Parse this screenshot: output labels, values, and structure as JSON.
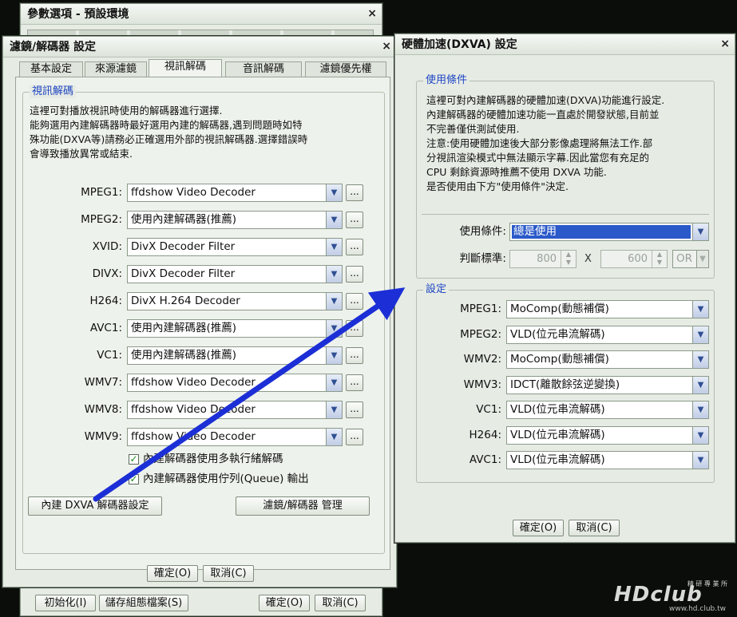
{
  "bg_window": {
    "title": "參數選項 - 預設環境",
    "close": "×",
    "footer": {
      "init_btn": "初始化(I)",
      "save_profile_btn": "儲存組態檔案(S)",
      "ok_btn": "確定(O)",
      "cancel_btn": "取消(C)"
    }
  },
  "filters_window": {
    "title": "濾鏡/解碼器 設定",
    "close": "×",
    "tabs": [
      {
        "label": "基本設定"
      },
      {
        "label": "來源濾鏡"
      },
      {
        "label": "視訊解碼"
      },
      {
        "label": "音訊解碼"
      },
      {
        "label": "濾鏡優先權"
      }
    ],
    "group_title": "視訊解碼",
    "desc_lines": [
      "這裡可對播放視訊時使用的解碼器進行選擇.",
      "能夠選用內建解碼器時最好選用內建的解碼器,遇到問題時如特",
      "殊功能(DXVA等)請務必正確選用外部的視訊解碼器.選擇錯誤時",
      "會導致播放異常或結束."
    ],
    "decoders": [
      {
        "label": "MPEG1:",
        "value": "ffdshow Video Decoder"
      },
      {
        "label": "MPEG2:",
        "value": "使用內建解碼器(推薦)"
      },
      {
        "label": "XVID:",
        "value": "DivX Decoder Filter"
      },
      {
        "label": "DIVX:",
        "value": "DivX Decoder Filter"
      },
      {
        "label": "H264:",
        "value": "DivX H.264 Decoder"
      },
      {
        "label": "AVC1:",
        "value": "使用內建解碼器(推薦)"
      },
      {
        "label": "VC1:",
        "value": "使用內建解碼器(推薦)"
      },
      {
        "label": "WMV7:",
        "value": "ffdshow Video Decoder"
      },
      {
        "label": "WMV8:",
        "value": "ffdshow Video Decoder"
      },
      {
        "label": "WMV9:",
        "value": "ffdshow Video Decoder"
      }
    ],
    "dots_label": "...",
    "checkbox1": {
      "label": "內建解碼器使用多執行緒解碼",
      "checked": true
    },
    "checkbox2": {
      "label": "內建解碼器使用佇列(Queue) 輸出",
      "checked": true
    },
    "dxva_btn": "內建 DXVA 解碼器設定",
    "manage_btn": "濾鏡/解碼器 管理",
    "ok_btn": "確定(O)",
    "cancel_btn": "取消(C)"
  },
  "dxva_window": {
    "title": "硬體加速(DXVA) 設定",
    "close": "×",
    "cond_group_title": "使用條件",
    "desc_lines": [
      "這裡可對內建解碼器的硬體加速(DXVA)功能進行設定.",
      "內建解碼器的硬體加速功能一直處於開發狀態,目前並",
      "不完善僅供測試使用.",
      "注意:使用硬體加速後大部分影像處理將無法工作.部",
      "分視訊渲染模式中無法顯示字幕.因此當您有充足的",
      "CPU 剩餘資源時推薦不使用 DXVA 功能.",
      "是否使用由下方\"使用條件\"決定."
    ],
    "condition_label": "使用條件:",
    "condition_value": "總是使用",
    "criteria_label": "判斷標準:",
    "width_value": "800",
    "x_sep": "X",
    "height_value": "600",
    "logic_value": "OR",
    "settings_group_title": "設定",
    "settings": [
      {
        "label": "MPEG1:",
        "value": "MoComp(動態補償)"
      },
      {
        "label": "MPEG2:",
        "value": "VLD(位元串流解碼)"
      },
      {
        "label": "WMV2:",
        "value": "MoComp(動態補償)"
      },
      {
        "label": "WMV3:",
        "value": "IDCT(離散餘弦逆變換)"
      },
      {
        "label": "VC1:",
        "value": "VLD(位元串流解碼)"
      },
      {
        "label": "H264:",
        "value": "VLD(位元串流解碼)"
      },
      {
        "label": "AVC1:",
        "value": "VLD(位元串流解碼)"
      }
    ],
    "ok_btn": "確定(O)",
    "cancel_btn": "取消(C)"
  },
  "logo": {
    "text": "HDclub",
    "small": "精 研 專 業 所",
    "url": "www.hd.club.tw"
  },
  "colors": {
    "accent": "#1f46c4",
    "arrow": "#1c2fd6",
    "selection": "#2a59c9",
    "window_bg": "#e6ebe4"
  },
  "icons": {
    "dropdown": "chevron-down-icon",
    "check": "checkmark-icon",
    "arrow": "annotation-arrow"
  }
}
